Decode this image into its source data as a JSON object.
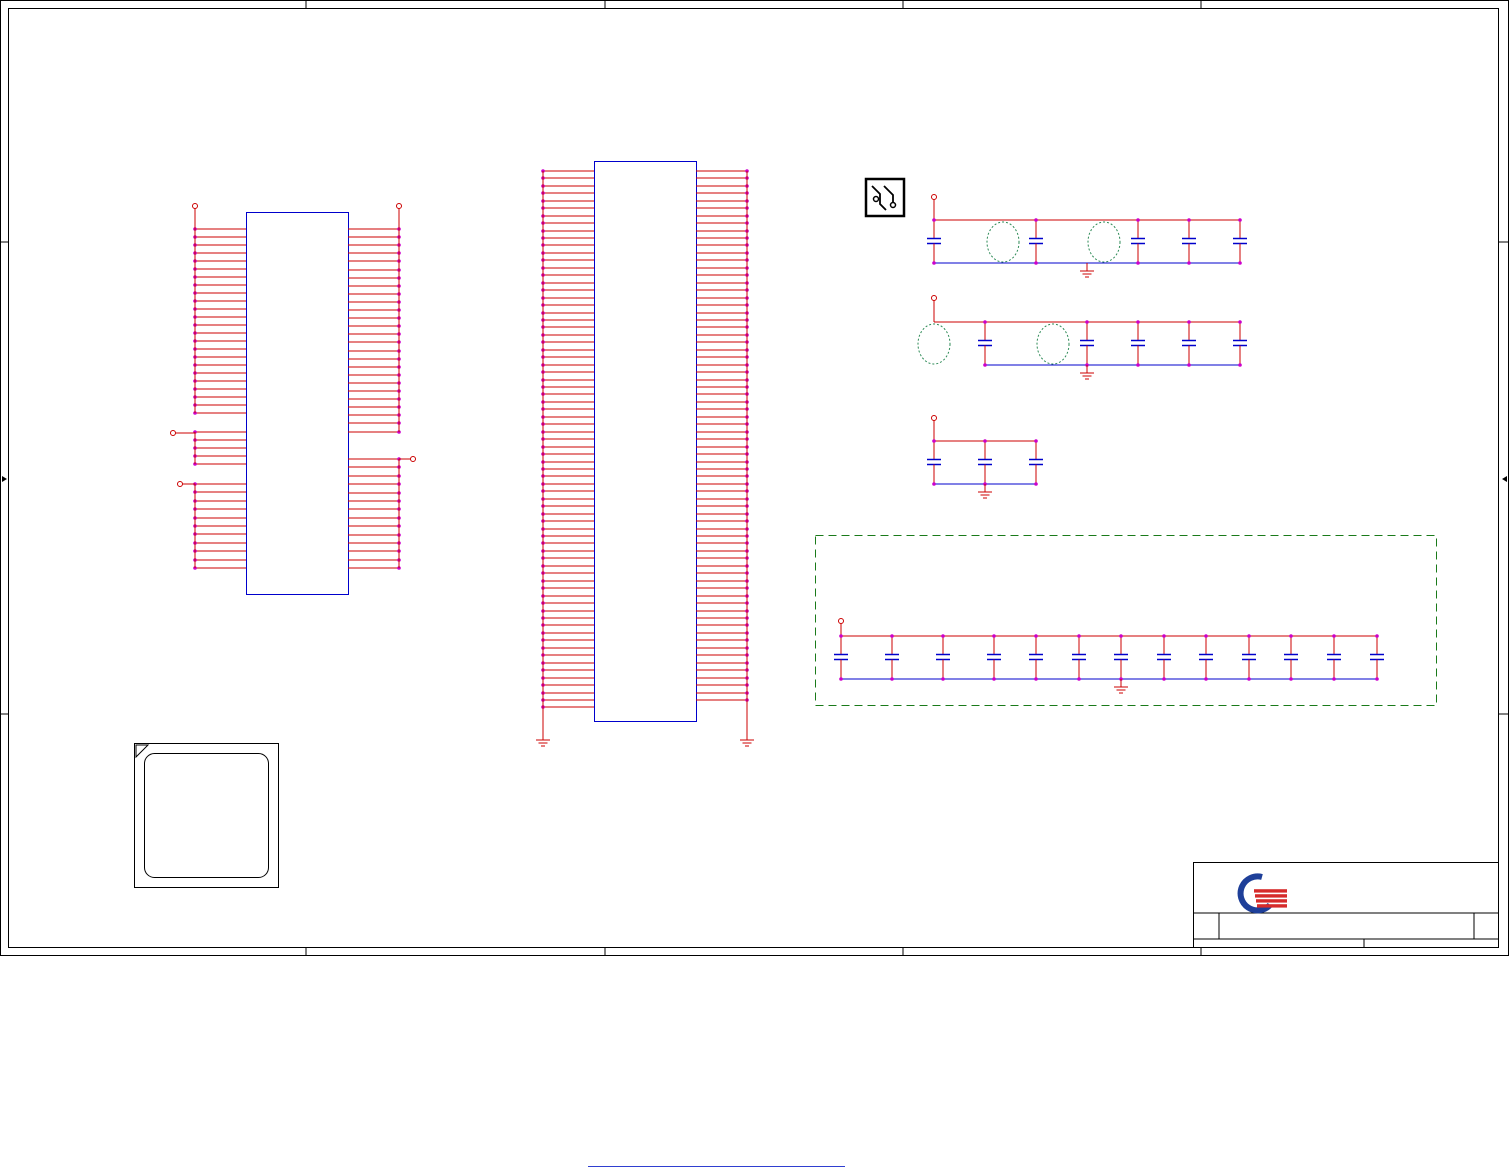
{
  "sheet": {
    "border_color": "#000000",
    "wire_color": "#cc0000",
    "junction_color": "#cc00cc",
    "component_color": "#0000cc",
    "placeholder_color": "#2e8b57",
    "dashed_box_color": "#1a7a1a"
  },
  "title_block": {
    "logo_icon": "company-logo",
    "logo_colors": [
      "#1e3f99",
      "#d62b2b"
    ]
  },
  "icons": {
    "pcb_icon": "pcb-trace-icon",
    "ground_icon": "ground-symbol-icon"
  }
}
